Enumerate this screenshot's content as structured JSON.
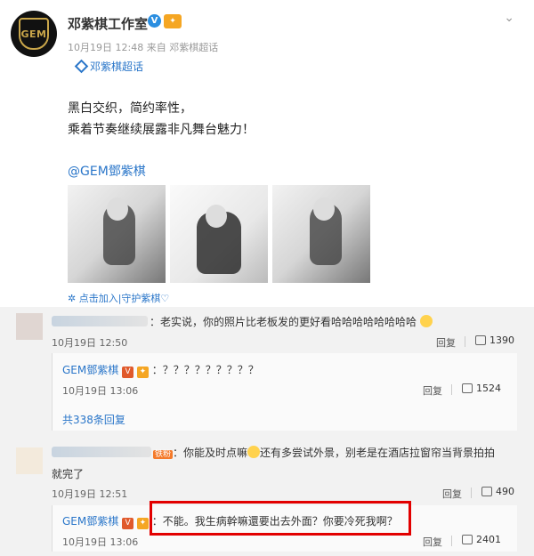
{
  "post": {
    "author": "邓紫棋工作室",
    "v_badge": "V",
    "time": "10月19日 12:48",
    "source_prefix": "来自",
    "source": "邓紫棋超话",
    "topic": "邓紫棋超话",
    "content_line1": "黑白交织，简约率性，",
    "content_line2": "乘着节奏继续展露非凡舞台魅力！",
    "mention": "@GEM鄧紫棋",
    "add_follow": "点击加入|守护紫棋♡"
  },
  "avatar_text": "GEM",
  "comments": [
    {
      "text": "：老实说，你的照片比老板发的更好看哈哈哈哈哈哈哈哈",
      "time": "10月19日 12:50",
      "reply_label": "回复",
      "likes": "1390"
    },
    {
      "author": "GEM鄧紫棋",
      "text": "：？？？？？？？？？",
      "time": "10月19日 13:06",
      "reply_label": "回复",
      "likes": "1524"
    },
    {
      "more": "共338条回复"
    },
    {
      "badge": "铁粉",
      "text_part1": "：你能及时点嘛",
      "text_part2": "还有多尝试外景，别老是在酒店拉窗帘当背景拍拍",
      "text_line2": "就完了",
      "time": "10月19日 12:51",
      "reply_label": "回复",
      "likes": "490"
    },
    {
      "author": "GEM鄧紫棋",
      "text": "：不能。我生病幹嘛還要出去外面？你要冷死我啊？",
      "time": "10月19日 13:06",
      "reply_label": "回复",
      "likes": "2401"
    }
  ],
  "colors": {
    "link": "#2a76c9",
    "highlight_box": "#e20000",
    "comment_bg": "#f2f2f2"
  }
}
